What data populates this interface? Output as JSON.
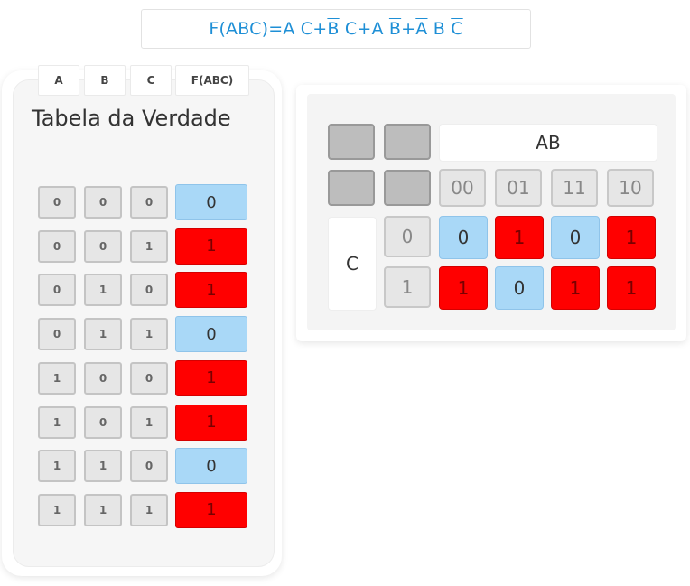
{
  "formula": {
    "segments": [
      {
        "text": "F(ABC)=A ",
        "bar": false
      },
      {
        "text": "C+",
        "bar": false
      },
      {
        "text": "B",
        "bar": true
      },
      {
        "text": " C+A ",
        "bar": false
      },
      {
        "text": "B",
        "bar": true
      },
      {
        "text": "+",
        "bar": false
      },
      {
        "text": "A",
        "bar": true
      },
      {
        "text": " B ",
        "bar": false
      },
      {
        "text": "C",
        "bar": true
      }
    ]
  },
  "truth_table": {
    "title": "Tabela da Verdade",
    "headers": [
      "A",
      "B",
      "C",
      "F(ABC)"
    ],
    "rows": [
      [
        "0",
        "0",
        "0",
        "0"
      ],
      [
        "0",
        "0",
        "1",
        "1"
      ],
      [
        "0",
        "1",
        "0",
        "1"
      ],
      [
        "0",
        "1",
        "1",
        "0"
      ],
      [
        "1",
        "0",
        "0",
        "1"
      ],
      [
        "1",
        "0",
        "1",
        "1"
      ],
      [
        "1",
        "1",
        "0",
        "0"
      ],
      [
        "1",
        "1",
        "1",
        "1"
      ]
    ]
  },
  "kmap": {
    "col_var": "AB",
    "row_var": "C",
    "col_codes": [
      "00",
      "01",
      "11",
      "10"
    ],
    "row_codes": [
      "0",
      "1"
    ],
    "cells": [
      [
        "0",
        "1",
        "0",
        "1"
      ],
      [
        "1",
        "0",
        "1",
        "1"
      ]
    ]
  },
  "colors": {
    "one": "#ff0000",
    "zero": "#a9d8f7",
    "formula": "#1e8fd6"
  }
}
